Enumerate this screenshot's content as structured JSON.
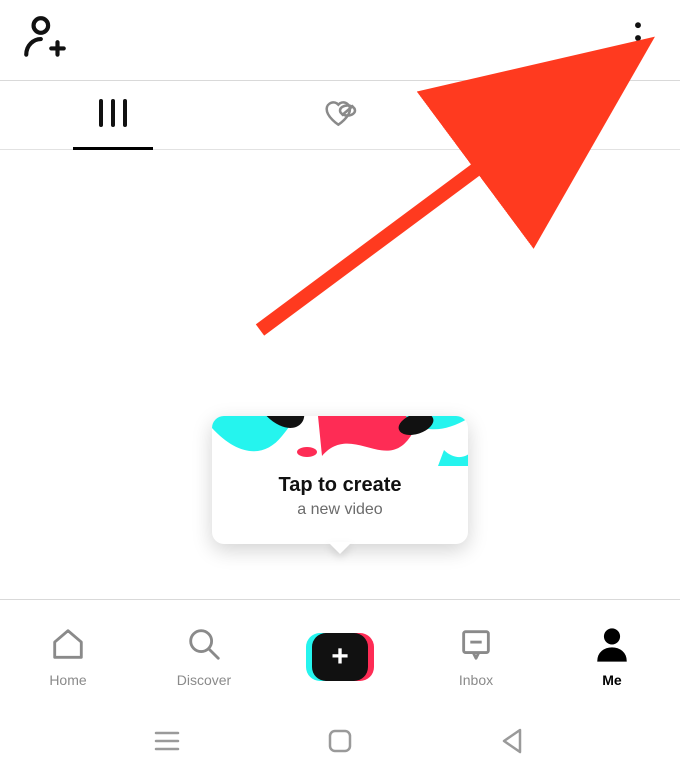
{
  "header": {
    "add_user_icon": "add-user",
    "more_icon": "more-vertical"
  },
  "profile_tabs": [
    {
      "id": "posts-grid",
      "active": true
    },
    {
      "id": "liked-hidden",
      "active": false
    },
    {
      "id": "private-lock",
      "active": false
    }
  ],
  "create_tooltip": {
    "title": "Tap to create",
    "subtitle": "a new video"
  },
  "bottom_nav": {
    "home": "Home",
    "discover": "Discover",
    "inbox": "Inbox",
    "me": "Me",
    "active": "me"
  },
  "colors": {
    "cyan": "#25F4EE",
    "pink": "#FE2C55",
    "arrow": "#FF3A1F"
  },
  "annotation": {
    "arrow_points_to": "more-options-button"
  }
}
